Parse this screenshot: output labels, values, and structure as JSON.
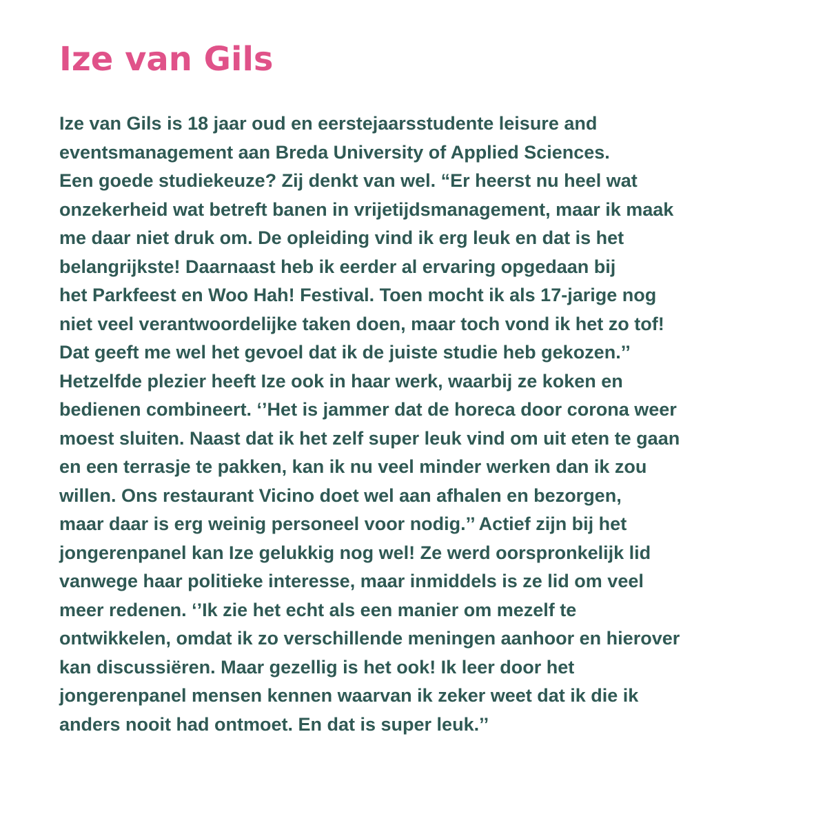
{
  "article": {
    "title": "Ize van Gils",
    "lines": [
      "Ize van Gils is 18 jaar oud en eerstejaarsstudente leisure and",
      "eventsmanagement aan Breda University of Applied Sciences.",
      "Een goede studiekeuze? Zij denkt van wel. “Er heerst nu heel wat",
      "onzekerheid wat betreft banen in vrijetijdsmanagement, maar ik maak",
      "me daar niet druk om. De opleiding vind ik erg leuk en dat is het",
      "belangrijkste! Daarnaast heb ik eerder al ervaring opgedaan bij",
      "het Parkfeest en Woo Hah! Festival. Toen mocht ik als 17-jarige nog",
      "niet veel verantwoordelijke taken doen, maar toch vond ik het zo tof!",
      "Dat geeft me wel het gevoel dat ik de juiste studie heb gekozen.’’",
      "Hetzelfde plezier heeft Ize ook in haar werk, waarbij ze koken en",
      "bedienen combineert. ‘’Het is jammer dat de horeca door corona weer",
      "moest sluiten. Naast dat ik het zelf super leuk vind om uit eten te gaan",
      "en een terrasje te pakken, kan ik nu veel minder werken dan ik zou",
      "willen. Ons restaurant Vicino doet wel aan afhalen en bezorgen,",
      "maar daar is erg weinig personeel voor nodig.’’ Actief zijn bij het",
      "jongerenpanel kan Ize gelukkig nog wel! Ze werd oorspronkelijk lid",
      "vanwege haar politieke interesse, maar inmiddels is ze lid om veel",
      "meer redenen. ‘’Ik zie het echt als een manier om mezelf te",
      "ontwikkelen, omdat ik zo verschillende meningen aanhoor en hierover",
      "kan discussiëren. Maar gezellig is het ook! Ik leer door het",
      "jongerenpanel mensen kennen waarvan ik zeker weet dat ik die ik",
      "anders nooit had ontmoet. En dat is super leuk.’’"
    ]
  }
}
